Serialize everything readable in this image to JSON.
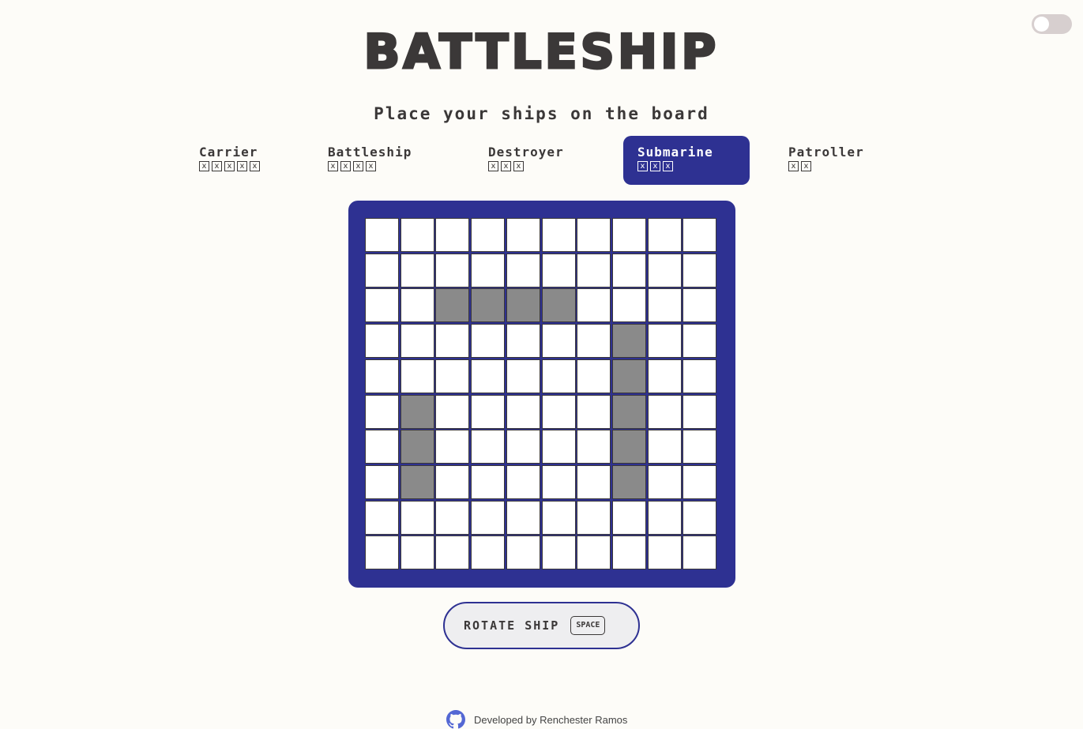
{
  "app": {
    "title": "BATTLESHIP",
    "subtitle": "Place your ships on the board"
  },
  "theme_toggle": {
    "state": "off"
  },
  "ships": [
    {
      "name": "Carrier",
      "size": 5,
      "selected": false
    },
    {
      "name": "Battleship",
      "size": 4,
      "selected": false
    },
    {
      "name": "Destroyer",
      "size": 3,
      "selected": false
    },
    {
      "name": "Submarine",
      "size": 3,
      "selected": true
    },
    {
      "name": "Patroller",
      "size": 2,
      "selected": false
    }
  ],
  "ship_cell_mark": "x",
  "board": {
    "rows": 10,
    "cols": 10,
    "placed_cells": [
      [
        2,
        2
      ],
      [
        2,
        3
      ],
      [
        2,
        4
      ],
      [
        2,
        5
      ],
      [
        3,
        7
      ],
      [
        4,
        7
      ],
      [
        5,
        7
      ],
      [
        6,
        7
      ],
      [
        7,
        7
      ],
      [
        5,
        1
      ],
      [
        6,
        1
      ],
      [
        7,
        1
      ]
    ]
  },
  "rotate_button": {
    "label": "ROTATE SHIP",
    "key": "SPACE"
  },
  "footer": {
    "text": "Developed by Renchester Ramos",
    "icon": "github-icon"
  },
  "colors": {
    "accent": "#2e3192",
    "text": "#3b3838",
    "background": "#fdfcf8",
    "placed": "#8a8a8a"
  }
}
